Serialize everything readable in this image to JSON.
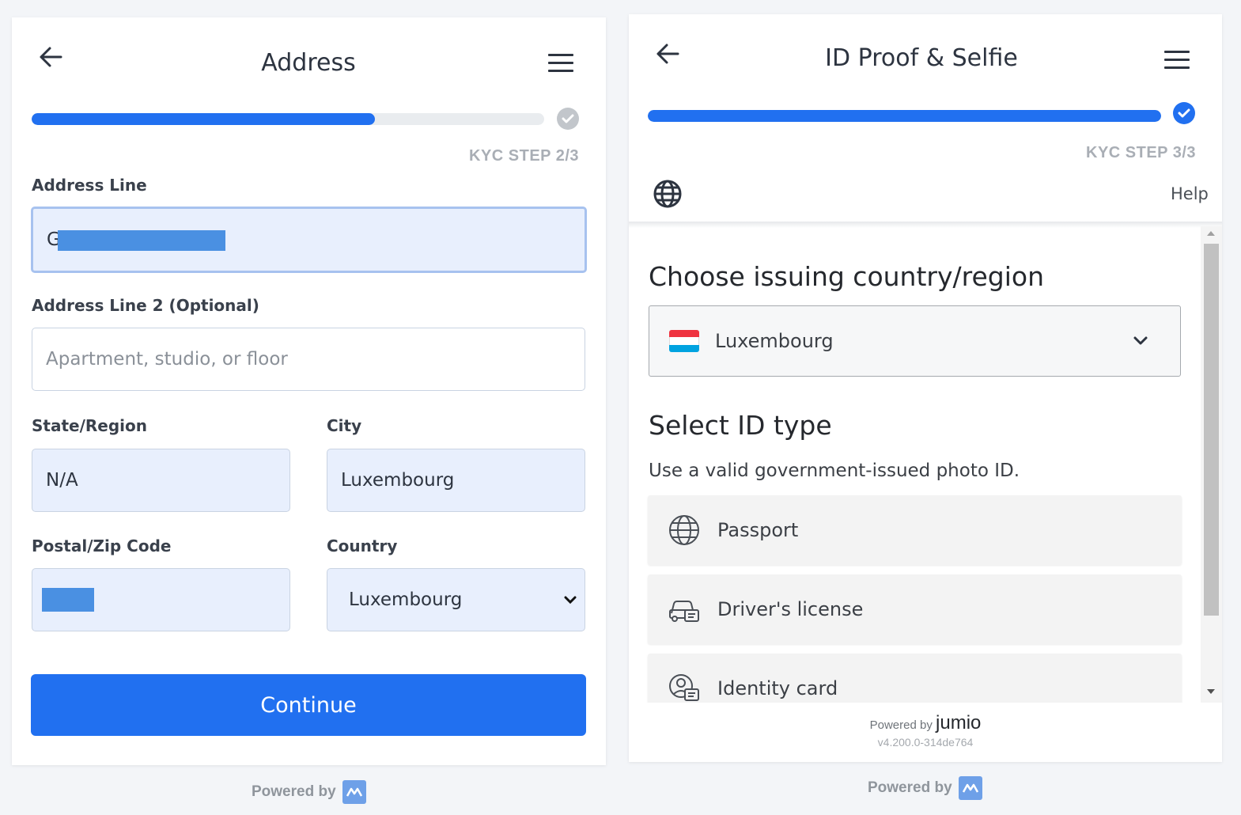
{
  "left": {
    "title": "Address",
    "progress": 0.67,
    "step_label": "KYC STEP 2/3",
    "address_line": {
      "label": "Address Line",
      "value": "G"
    },
    "address_line2": {
      "label": "Address Line 2 (Optional)",
      "placeholder": "Apartment, studio, or floor"
    },
    "state": {
      "label": "State/Region",
      "value": "N/A"
    },
    "city": {
      "label": "City",
      "value": "Luxembourg"
    },
    "postal": {
      "label": "Postal/Zip Code",
      "value": ""
    },
    "country": {
      "label": "Country",
      "value": "Luxembourg"
    },
    "continue_label": "Continue",
    "powered_by": "Powered by"
  },
  "right": {
    "title": "ID Proof & Selfie",
    "progress": 1.0,
    "step_label": "KYC STEP 3/3",
    "help_label": "Help",
    "country_heading": "Choose issuing country/region",
    "country_value": "Luxembourg",
    "id_heading": "Select ID type",
    "id_subtext": "Use a valid government-issued photo ID.",
    "id_options": [
      {
        "label": "Passport",
        "icon": "globe-icon"
      },
      {
        "label": "Driver's license",
        "icon": "car-id-icon"
      },
      {
        "label": "Identity card",
        "icon": "identity-card-icon"
      }
    ],
    "footer_powered": "Powered by",
    "footer_brand": "jumio",
    "version": "v4.200.0-314de764",
    "powered_by": "Powered by"
  },
  "colors": {
    "accent": "#2170f0",
    "field_bg": "#e8effd",
    "flag_red": "#ef3340",
    "flag_white": "#ffffff",
    "flag_blue": "#00a3e0"
  }
}
